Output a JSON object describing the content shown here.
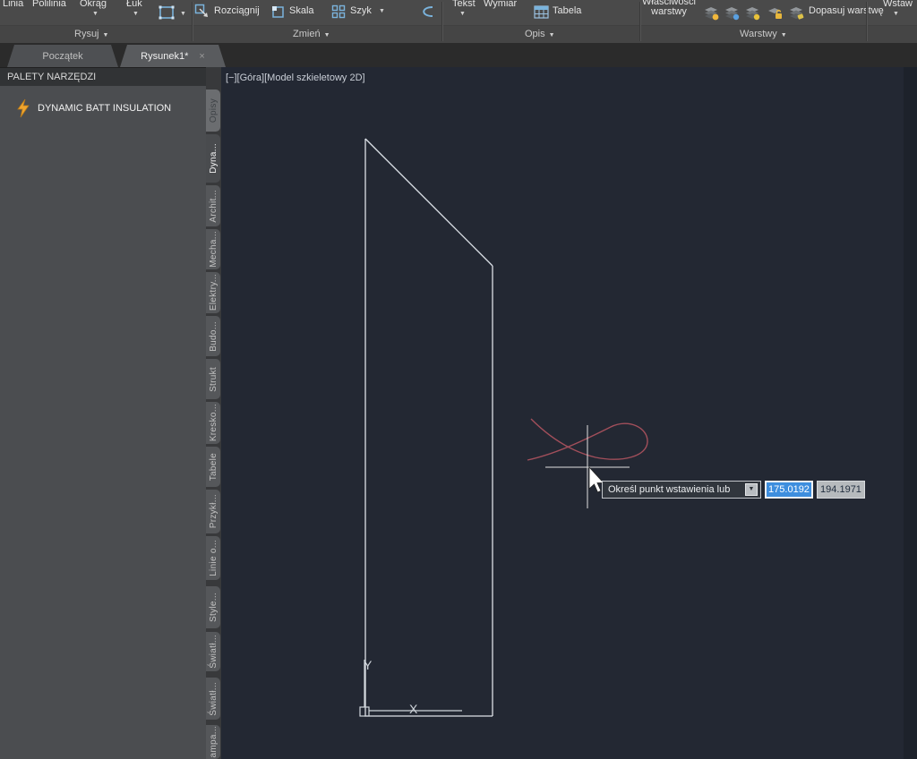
{
  "ribbon": {
    "draw": {
      "title": "Rysuj",
      "linia": "Linia",
      "polilinia": "Polilinia",
      "okrag": "Okrąg",
      "luk": "Łuk"
    },
    "modify": {
      "title": "Zmień",
      "rozciagnij": "Rozciągnij",
      "skala": "Skala",
      "szyk": "Szyk"
    },
    "annotate": {
      "title": "Opis",
      "tekst": "Tekst",
      "wymiar": "Wymiar",
      "tabela": "Tabela"
    },
    "layers": {
      "title": "Warstwy",
      "properties_line1": "Właściwości",
      "properties_line2": "warstwy",
      "match": "Dopasuj warstwę"
    },
    "insert": {
      "title": "Wstaw"
    }
  },
  "file_tabs": {
    "start": "Początek",
    "drawing": "Rysunek1*",
    "close": "×",
    "new": "+"
  },
  "palette": {
    "header": "PALETY NARZĘDZI",
    "item": "DYNAMIC BATT INSULATION",
    "tabs": [
      "Opisy",
      "Dyna...",
      "Archit...",
      "Mecha...",
      "Elektry...",
      "Budo...",
      "Strukt",
      "Kresko...",
      "Tabele",
      "Przykł...",
      "Linie o...",
      "Style...",
      "Światł...",
      "Światł...",
      "ampa..."
    ]
  },
  "canvas": {
    "viewport_label": "[−][Góra][Model szkieletowy 2D]",
    "ucs_x": "X",
    "ucs_y": "Y"
  },
  "dynamic_input": {
    "prompt": "Określ punkt wstawienia lub",
    "x_value": "175.0192",
    "y_value": "194.1971"
  },
  "colors": {
    "canvas_bg": "#232833",
    "geometry": "#dde2e8",
    "spline": "#a24f5b",
    "selection": "#3e8ede",
    "icon_blue": "#7ab3dc",
    "bolt_orange": "#f0a52e"
  }
}
